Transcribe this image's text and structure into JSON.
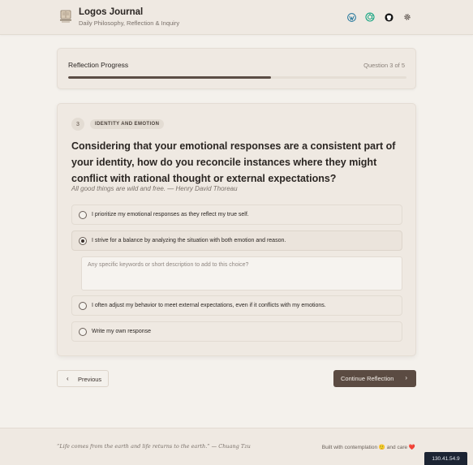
{
  "header": {
    "title": "Logos Journal",
    "subtitle": "Daily Philosophy, Reflection & Inquiry",
    "icons": [
      "wordpress-icon",
      "openai-icon",
      "github-icon",
      "settings-gear-icon"
    ],
    "colors": {
      "wordpress": "#21759b",
      "openai": "#10a37f",
      "github": "#111111"
    }
  },
  "progress": {
    "title": "Reflection Progress",
    "count_text": "Question 3 of 5",
    "value": 0.6
  },
  "question": {
    "number": "3",
    "category": "IDENTITY AND EMOTION",
    "text": "Considering that your emotional responses are a consistent part of your identity, how do you reconcile instances where they might conflict with rational thought or external expectations?",
    "quote": "All good things are wild and free. — Henry David Thoreau",
    "options": [
      {
        "label": "I prioritize my emotional responses as they reflect my true self.",
        "selected": false
      },
      {
        "label": "I strive for a balance by analyzing the situation with both emotion and reason.",
        "selected": true
      },
      {
        "label": "I often adjust my behavior to meet external expectations, even if it conflicts with my emotions.",
        "selected": false
      },
      {
        "label": "Write my own response",
        "selected": false
      }
    ],
    "detail_placeholder": "Any specific keywords or short description to add to this choice?",
    "detail_value": ""
  },
  "nav": {
    "previous_label": "Previous",
    "continue_label": "Continue Reflection"
  },
  "footer": {
    "quote": "“Life comes from the earth and life returns to the earth.” — Chuang Tzu",
    "built_text": "Built with contemplation",
    "and_care": "and care",
    "emoji_1": "🙂",
    "emoji_2": "❤️"
  },
  "ip_badge": "130.41.54.9",
  "theme": {
    "accent": "#5b4b42",
    "background": "#f4f1ec",
    "card": "#efe9e2"
  }
}
